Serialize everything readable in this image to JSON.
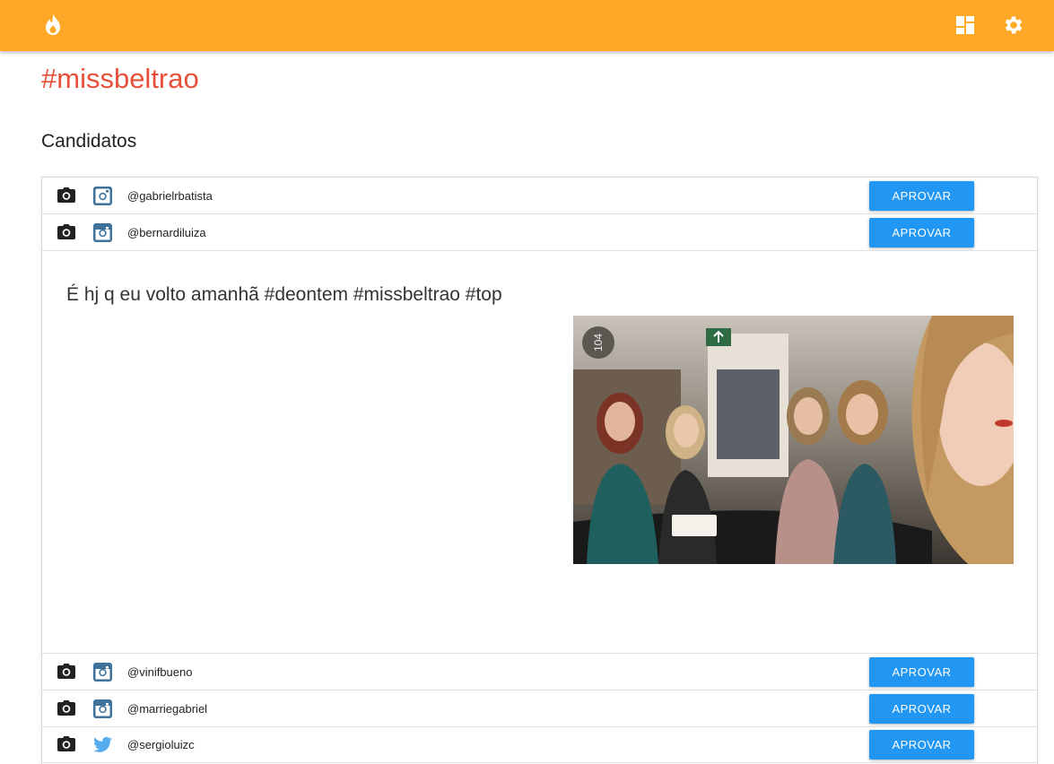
{
  "header": {
    "logo_icon": "flame-icon",
    "dashboard_icon": "dashboard-icon",
    "settings_icon": "gear-icon",
    "bar_color": "#FFA726"
  },
  "page": {
    "title": "#missbeltrao",
    "section_title": "Candidatos",
    "title_color": "#E8503A"
  },
  "candidates": [
    {
      "handle": "@gabrielrbatista",
      "network": "instagram",
      "action": "APROVAR"
    },
    {
      "handle": "@bernardiluiza",
      "network": "instagram",
      "action": "APROVAR"
    },
    {
      "handle": "@vinifbueno",
      "network": "instagram",
      "action": "APROVAR"
    },
    {
      "handle": "@marriegabriel",
      "network": "instagram",
      "action": "APROVAR"
    },
    {
      "handle": "@sergioluizc",
      "network": "twitter",
      "action": "APROVAR"
    }
  ],
  "expanded_post": {
    "caption": "É hj q eu volto amanhã #deontem #missbeltrao #top",
    "photo_badge": "104"
  },
  "colors": {
    "approve_button": "#2196F3",
    "twitter": "#55ACEE",
    "instagram": "#3F729B"
  }
}
